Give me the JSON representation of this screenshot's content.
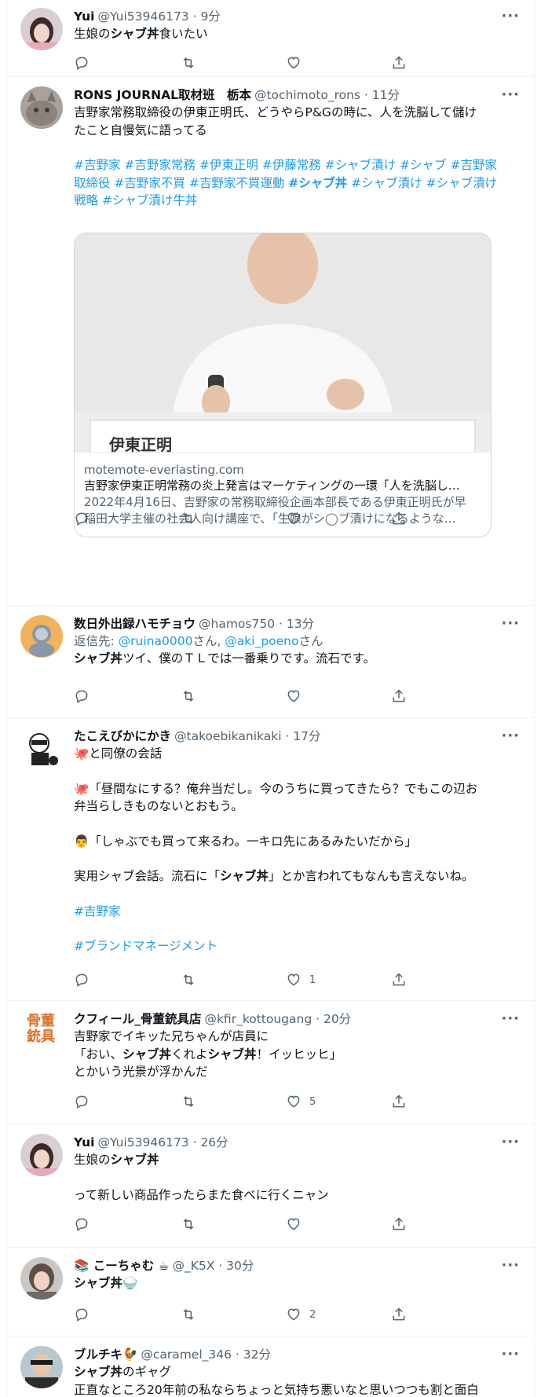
{
  "tweets": [
    {
      "name": "Yui",
      "handle": "@Yui53946173 · 9分",
      "text": [
        "生娘の",
        "シャブ丼",
        "食いたい"
      ],
      "likes": ""
    },
    {
      "name": "RONS JOURNAL取材班　栃本",
      "handle": "@tochimoto_rons · 11分",
      "text_lines": [
        "吉野家常務取締役の伊東正明氏、どうやらP&Gの時に、人を洗脳して儲け",
        "たこと自慢気に語ってる"
      ],
      "hashtags_l1": "#吉野家 #吉野家常務 #伊東正明 #伊藤常務 #シャブ漬け #シャブ #吉野家",
      "hashtags_l2_a": "取締役 #吉野家不買 #吉野家不買運動 ",
      "hashtags_l2_b": "#シャブ丼",
      "hashtags_l2_c": " #シャブ漬け #シャブ漬け",
      "hashtags_l3": "戦略 #シャブ漬け牛丼",
      "card": {
        "img_text": "伊東正明",
        "domain": "motemote-everlasting.com",
        "title": "吉野家伊東正明常務の炎上発言はマーケティングの一環「人を洗脳し…",
        "desc_l1": "2022年4月16日、吉野家の常務取締役企画本部長である伊東正明氏が早",
        "desc_l2": "稲田大学主催の社会人向け講座で、「生娘がシ◯ブ漬けになるような…"
      },
      "likes": ""
    },
    {
      "name": "数日外出録ハモチョウ",
      "handle": "@hamos750 · 13分",
      "reply_prefix": "返信先: ",
      "reply_at1": "@ruina0000",
      "reply_mid": "さん, ",
      "reply_at2": "@aki_poeno",
      "reply_suffix": "さん",
      "text_b": "シャブ丼",
      "text_rest": "ツイ、僕のＴＬでは一番乗りです。流石です。",
      "likes": ""
    },
    {
      "name": "たこえびかにかき",
      "handle": "@takoebikanikaki · 17分",
      "l1": "🐙と同僚の会話",
      "l2": "🐙「昼間なにする？俺弁当だし。今のうちに買ってきたら？でもこの辺お",
      "l3": "弁当らしきものないとおもう。",
      "l4": "👨「しゃぶでも買って来るわ。一キロ先にあるみたいだから」",
      "l5_a": "実用シャブ会話。流石に「",
      "l5_b": "シャブ丼",
      "l5_c": "」とか言われてもなんも言えないね。",
      "tag1": "#吉野家",
      "tag2": "#ブランドマネージメント",
      "likes": "1"
    },
    {
      "name": "クフィール_骨董銃具店",
      "handle": "@kfir_kottougang · 20分",
      "avatar_text": [
        "骨董",
        "銃具"
      ],
      "l1": "吉野家でイキッた兄ちゃんが店員に",
      "l2_a": "「おい、",
      "l2_b": "シャブ丼",
      "l2_c": "くれよ",
      "l2_d": "シャブ丼",
      "l2_e": "！イッヒッヒ」",
      "l3": "とかいう光景が浮かんだ",
      "likes": "5"
    },
    {
      "name": "Yui",
      "handle": "@Yui53946173 · 26分",
      "l1_a": "生娘の",
      "l1_b": "シャブ丼",
      "l2": "って新しい商品作ったらまた食べに行くニャン",
      "likes": ""
    },
    {
      "name": "📚 こーちゃむ ☕",
      "handle": "@_K5X · 30分",
      "text_b": "シャブ丼",
      "emoji": "🍚",
      "likes": "2"
    },
    {
      "name": "ブルチキ🐓",
      "handle": "@caramel_346 · 32分",
      "l1_a": "シャブ丼",
      "l1_b": "のギャグ",
      "l2": "正直なところ20年前の私ならちょっと気持ち悪いなと思いつつも割と面白"
    }
  ],
  "ui": {
    "more": "···"
  },
  "colors": {
    "link": "#1d9bf0",
    "secondary": "#536471",
    "border": "#eff3f4"
  }
}
